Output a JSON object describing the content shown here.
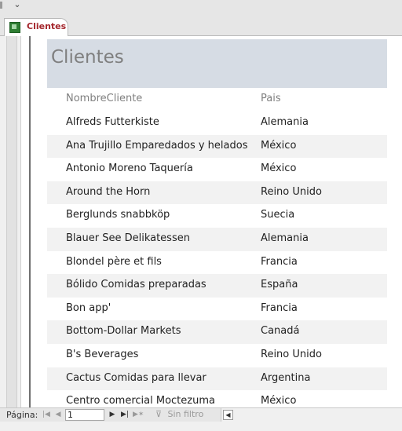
{
  "tab": {
    "label": "Clientes"
  },
  "form": {
    "title": "Clientes",
    "columns": [
      "NombreCliente",
      "Pais"
    ],
    "rows": [
      [
        "Alfreds Futterkiste",
        "Alemania"
      ],
      [
        "Ana Trujillo Emparedados y helados",
        "México"
      ],
      [
        "Antonio Moreno Taquería",
        "México"
      ],
      [
        "Around the Horn",
        "Reino Unido"
      ],
      [
        "Berglunds snabbköp",
        "Suecia"
      ],
      [
        "Blauer See Delikatessen",
        "Alemania"
      ],
      [
        "Blondel père et fils",
        "Francia"
      ],
      [
        "Bólido Comidas preparadas",
        "España"
      ],
      [
        "Bon app'",
        "Francia"
      ],
      [
        "Bottom-Dollar Markets",
        "Canadá"
      ],
      [
        "B's Beverages",
        "Reino Unido"
      ],
      [
        "Cactus Comidas para llevar",
        "Argentina"
      ],
      [
        "Centro comercial Moctezuma",
        "México"
      ]
    ]
  },
  "navigation": {
    "page_label": "Página:",
    "page_value": "1",
    "filter_label": "Sin filtro"
  }
}
